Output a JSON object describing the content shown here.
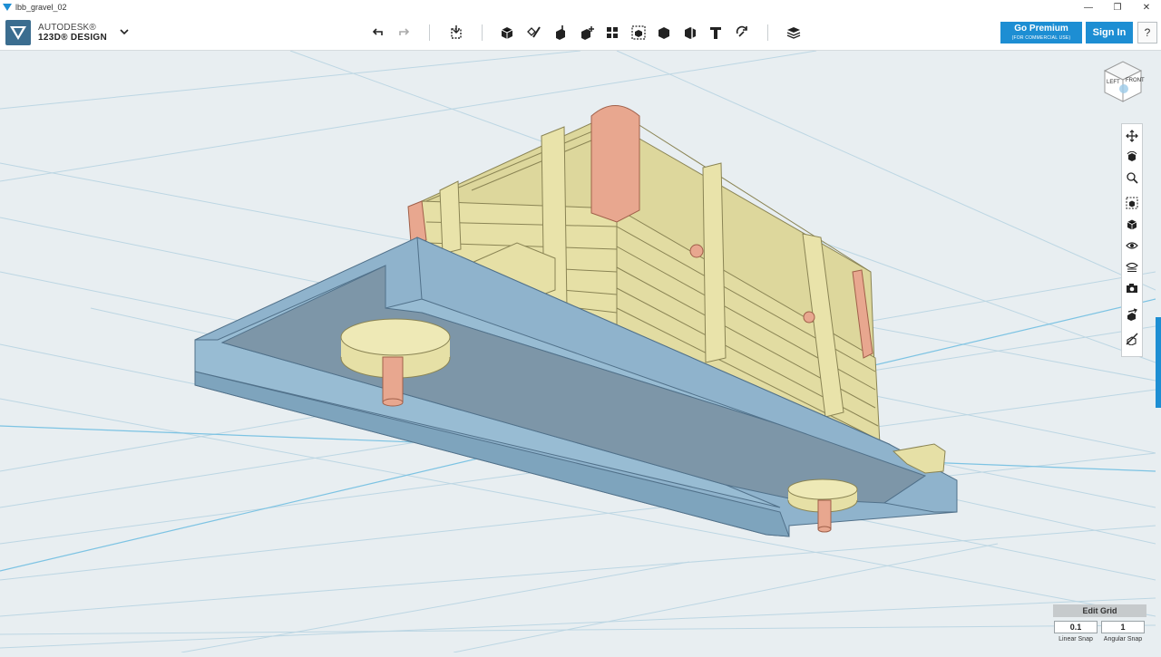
{
  "window": {
    "title": "lbb_gravel_02",
    "controls": [
      "—",
      "❐",
      "✕"
    ]
  },
  "brand": {
    "line1": "AUTODESK®",
    "line2": "123D® DESIGN"
  },
  "toolbar": {
    "tools": [
      {
        "name": "undo-icon"
      },
      {
        "name": "redo-icon"
      },
      {
        "name": "transform-icon"
      },
      {
        "name": "primitives-icon"
      },
      {
        "name": "sketch-icon"
      },
      {
        "name": "construct-icon"
      },
      {
        "name": "modify-icon"
      },
      {
        "name": "pattern-icon"
      },
      {
        "name": "group-icon"
      },
      {
        "name": "combine-icon"
      },
      {
        "name": "measure-icon"
      },
      {
        "name": "text-icon"
      },
      {
        "name": "snap-icon"
      },
      {
        "name": "material-icon"
      }
    ],
    "go_premium": "Go Premium",
    "go_premium_sub": "(FOR COMMERCIAL USE)",
    "sign_in": "Sign In",
    "help": "?"
  },
  "viewcube": {
    "left": "LEFT",
    "front": "FRONT"
  },
  "navbar": {
    "items": [
      "pan-icon",
      "orbit-icon",
      "zoom-icon",
      "fit-icon",
      "view-icon",
      "visibility-icon",
      "materials-icon",
      "screenshot-icon",
      "snap-tool-icon",
      "hide-icon"
    ]
  },
  "grid": {
    "edit_label": "Edit Grid",
    "linear_snap_value": "0.1",
    "angular_snap_value": "1",
    "linear_snap_label": "Linear Snap",
    "angular_snap_label": "Angular Snap"
  },
  "colors": {
    "accent": "#1d8ed3",
    "base_plate": "#8fb3cc",
    "crate": "#e6e0a6",
    "post": "#e8a78f",
    "background": "#e8eef1"
  }
}
